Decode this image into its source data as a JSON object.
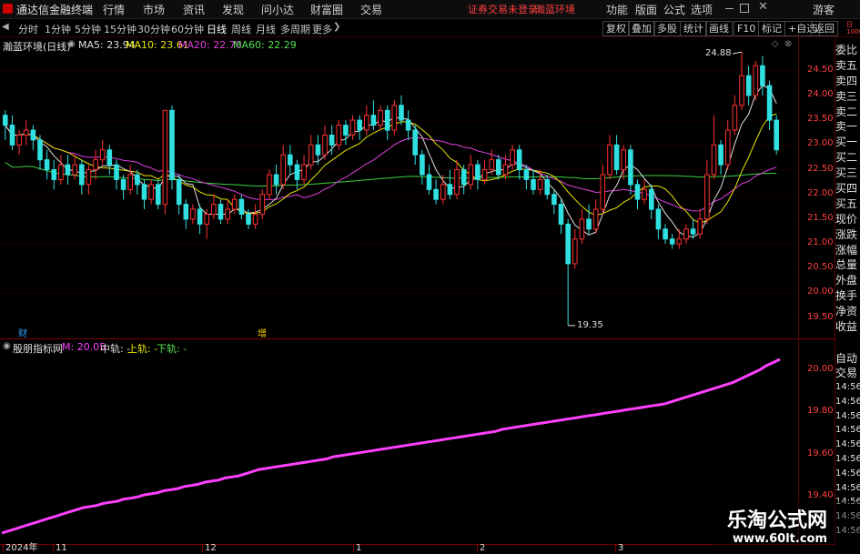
{
  "menubar": {
    "app_title": "通达信金融终端",
    "items": [
      "行情",
      "市场",
      "资讯",
      "发现",
      "问小达",
      "财富圈",
      "交易"
    ],
    "notice": "证券交易未登录",
    "stock_name_red": "瀚蓝环境",
    "right_items": [
      "功能",
      "版面",
      "公式",
      "选项"
    ],
    "guest": "游客"
  },
  "toolbar": {
    "periods": [
      "分时",
      "1分钟",
      "5分钟",
      "15分钟",
      "30分钟",
      "60分钟",
      "日线",
      "周线",
      "月线",
      "多周期",
      "更多"
    ],
    "active_period": "日线",
    "right_buttons": [
      "复权",
      "叠加",
      "多股",
      "统计",
      "画线",
      "F10",
      "标记",
      "+自选",
      "返回"
    ]
  },
  "chart_header": {
    "title": "瀚蓝环境(日线)",
    "ma5": "MA5: 23.94",
    "ma10": "MA10: 23.61",
    "ma20": "MA20: 22.70",
    "ma60": "MA60: 22.29"
  },
  "side_panel": {
    "items": [
      "委比",
      "卖五",
      "卖四",
      "卖三",
      "卖二",
      "卖一",
      "买一",
      "买二",
      "买三",
      "买四",
      "买五",
      "现价",
      "涨跌",
      "涨幅",
      "总量",
      "外盘",
      "换手",
      "净资",
      "收益"
    ],
    "bottom_items": [
      "自动",
      "交易"
    ],
    "times": [
      "14:56",
      "14:56",
      "14:56",
      "14:56",
      "14:56",
      "14:56",
      "14:56",
      "14:56",
      "14:56",
      "14:56",
      "14:56"
    ],
    "top_tag": "日 1000"
  },
  "price_axis": [
    "24.50",
    "24.00",
    "23.50",
    "23.00",
    "22.50",
    "22.00",
    "21.50",
    "21.00",
    "20.50",
    "20.00",
    "19.50"
  ],
  "annotations": {
    "high": "24.88",
    "low": "19.35",
    "marker_cai": "财",
    "marker_zeng": "增"
  },
  "indicator": {
    "name": "殷朋指标网",
    "m_label": "M: 20.05",
    "mid_label": "中轨: -",
    "upper_label": "上轨: -",
    "lower_label": "下轨: -",
    "axis": [
      "20.00",
      "19.80",
      "19.60",
      "19.40"
    ]
  },
  "date_axis": [
    "2024年",
    "11",
    "12",
    "1",
    "2",
    "3"
  ],
  "watermark": {
    "title": "乐淘公式网",
    "url": "www.60lt.com"
  },
  "colors": {
    "up": "#ff3030",
    "down": "#30e0e0",
    "ma5": "#e0e0e0",
    "ma10": "#e6e600",
    "ma20": "#e040e0",
    "ma60": "#40d040",
    "indicator": "#ff40ff"
  },
  "chart_data": {
    "type": "candlestick",
    "ylim": [
      19.2,
      24.9
    ],
    "candles": [
      [
        23.6,
        23.4,
        23.7,
        23.1
      ],
      [
        23.4,
        23.0,
        23.6,
        22.9
      ],
      [
        23.0,
        23.2,
        23.3,
        22.8
      ],
      [
        23.2,
        23.3,
        23.5,
        23.0
      ],
      [
        23.3,
        23.1,
        23.4,
        22.9
      ],
      [
        23.1,
        22.7,
        23.2,
        22.5
      ],
      [
        22.7,
        22.5,
        22.9,
        22.3
      ],
      [
        22.5,
        22.3,
        22.7,
        22.1
      ],
      [
        22.3,
        22.6,
        22.8,
        22.2
      ],
      [
        22.6,
        22.4,
        22.8,
        22.2
      ],
      [
        22.4,
        22.6,
        22.8,
        22.3
      ],
      [
        22.6,
        22.2,
        22.7,
        22.0
      ],
      [
        22.2,
        22.5,
        22.6,
        22.0
      ],
      [
        22.5,
        22.7,
        22.9,
        22.3
      ],
      [
        22.7,
        22.9,
        23.1,
        22.6
      ],
      [
        22.9,
        22.6,
        23.0,
        22.4
      ],
      [
        22.6,
        22.3,
        22.7,
        22.1
      ],
      [
        22.3,
        22.1,
        22.4,
        21.9
      ],
      [
        22.1,
        22.4,
        22.6,
        22.0
      ],
      [
        22.4,
        22.2,
        22.5,
        22.0
      ],
      [
        22.2,
        21.9,
        22.3,
        21.7
      ],
      [
        21.9,
        22.2,
        22.3,
        21.8
      ],
      [
        22.2,
        21.8,
        22.3,
        21.7
      ],
      [
        21.8,
        23.7,
        23.7,
        21.6
      ],
      [
        23.7,
        22.3,
        23.8,
        22.1
      ],
      [
        22.3,
        21.8,
        22.4,
        21.6
      ],
      [
        21.8,
        21.5,
        21.9,
        21.3
      ],
      [
        21.5,
        21.7,
        21.8,
        21.4
      ],
      [
        21.7,
        21.4,
        21.8,
        21.2
      ],
      [
        21.4,
        21.6,
        21.7,
        21.1
      ],
      [
        21.6,
        21.8,
        22.0,
        21.5
      ],
      [
        21.8,
        21.5,
        21.9,
        21.4
      ],
      [
        21.5,
        21.7,
        21.9,
        21.4
      ],
      [
        21.7,
        21.9,
        22.0,
        21.6
      ],
      [
        21.9,
        21.6,
        22.0,
        21.5
      ],
      [
        21.6,
        21.4,
        21.7,
        21.3
      ],
      [
        21.4,
        21.6,
        21.8,
        21.3
      ],
      [
        21.6,
        22.0,
        22.1,
        21.5
      ],
      [
        22.0,
        22.4,
        22.5,
        21.9
      ],
      [
        22.4,
        22.2,
        22.6,
        22.0
      ],
      [
        22.2,
        22.8,
        23.0,
        22.1
      ],
      [
        22.8,
        22.6,
        23.0,
        22.4
      ],
      [
        22.6,
        22.3,
        22.7,
        22.1
      ],
      [
        22.3,
        22.6,
        22.8,
        22.2
      ],
      [
        22.6,
        23.0,
        23.2,
        22.5
      ],
      [
        23.0,
        22.8,
        23.2,
        22.6
      ],
      [
        22.8,
        23.2,
        23.4,
        22.7
      ],
      [
        23.2,
        23.0,
        23.4,
        22.8
      ],
      [
        23.0,
        23.4,
        23.5,
        22.9
      ],
      [
        23.4,
        23.2,
        23.5,
        23.0
      ],
      [
        23.2,
        23.5,
        23.6,
        23.1
      ],
      [
        23.5,
        23.3,
        23.6,
        23.1
      ],
      [
        23.3,
        23.6,
        23.8,
        23.2
      ],
      [
        23.6,
        23.4,
        23.9,
        23.3
      ],
      [
        23.4,
        23.7,
        23.8,
        23.3
      ],
      [
        23.7,
        23.3,
        23.8,
        23.1
      ],
      [
        23.3,
        23.8,
        23.9,
        23.2
      ],
      [
        23.8,
        23.5,
        24.0,
        23.4
      ],
      [
        23.5,
        23.3,
        23.7,
        23.1
      ],
      [
        23.3,
        22.8,
        23.4,
        22.6
      ],
      [
        22.8,
        22.4,
        22.9,
        22.2
      ],
      [
        22.4,
        22.1,
        22.6,
        22.0
      ],
      [
        22.1,
        21.9,
        22.3,
        21.8
      ],
      [
        21.9,
        22.2,
        22.4,
        21.8
      ],
      [
        22.2,
        22.0,
        22.5,
        21.9
      ],
      [
        22.0,
        22.5,
        22.7,
        21.9
      ],
      [
        22.5,
        22.2,
        22.6,
        22.0
      ],
      [
        22.2,
        22.6,
        22.8,
        22.1
      ],
      [
        22.6,
        22.3,
        22.7,
        22.1
      ],
      [
        22.3,
        22.5,
        22.7,
        22.2
      ],
      [
        22.5,
        22.7,
        22.9,
        22.4
      ],
      [
        22.7,
        22.4,
        22.8,
        22.3
      ],
      [
        22.4,
        22.6,
        22.8,
        22.3
      ],
      [
        22.6,
        22.9,
        23.0,
        22.5
      ],
      [
        22.9,
        22.5,
        23.0,
        22.3
      ],
      [
        22.5,
        22.3,
        22.6,
        22.1
      ],
      [
        22.3,
        22.1,
        22.5,
        22.0
      ],
      [
        22.1,
        22.3,
        22.5,
        22.0
      ],
      [
        22.3,
        22.0,
        22.4,
        21.9
      ],
      [
        22.0,
        21.8,
        22.1,
        21.6
      ],
      [
        21.8,
        21.4,
        21.9,
        21.2
      ],
      [
        21.4,
        20.6,
        21.5,
        19.35
      ],
      [
        20.6,
        21.1,
        21.3,
        20.5
      ],
      [
        21.1,
        21.5,
        21.7,
        21.0
      ],
      [
        21.5,
        21.3,
        21.8,
        21.2
      ],
      [
        21.3,
        21.7,
        21.9,
        21.2
      ],
      [
        21.7,
        22.4,
        22.6,
        21.6
      ],
      [
        22.4,
        23.0,
        23.2,
        22.3
      ],
      [
        23.0,
        22.5,
        23.2,
        22.4
      ],
      [
        22.5,
        22.9,
        23.0,
        22.3
      ],
      [
        22.9,
        22.2,
        23.0,
        22.0
      ],
      [
        22.2,
        21.9,
        22.3,
        21.7
      ],
      [
        21.9,
        22.1,
        22.3,
        21.8
      ],
      [
        22.1,
        21.7,
        22.2,
        21.5
      ],
      [
        21.7,
        21.3,
        21.8,
        21.1
      ],
      [
        21.3,
        21.1,
        21.4,
        21.0
      ],
      [
        21.1,
        21.0,
        21.2,
        20.9
      ],
      [
        21.0,
        21.1,
        21.3,
        20.9
      ],
      [
        21.1,
        21.3,
        21.4,
        21.0
      ],
      [
        21.3,
        21.2,
        21.5,
        21.1
      ],
      [
        21.2,
        21.5,
        21.7,
        21.1
      ],
      [
        21.5,
        22.4,
        22.7,
        21.4
      ],
      [
        22.4,
        23.0,
        23.6,
        22.3
      ],
      [
        23.0,
        22.6,
        23.1,
        22.4
      ],
      [
        22.6,
        23.3,
        23.5,
        22.5
      ],
      [
        23.3,
        23.8,
        24.0,
        23.2
      ],
      [
        23.8,
        24.4,
        24.88,
        23.7
      ],
      [
        24.4,
        24.0,
        24.6,
        23.8
      ],
      [
        24.0,
        24.6,
        24.7,
        23.9
      ],
      [
        24.6,
        24.2,
        24.8,
        24.0
      ],
      [
        24.2,
        23.5,
        24.3,
        23.3
      ],
      [
        23.5,
        22.9,
        23.6,
        22.8
      ]
    ],
    "indicator_values": [
      19.23,
      19.24,
      19.25,
      19.26,
      19.27,
      19.28,
      19.29,
      19.3,
      19.31,
      19.32,
      19.33,
      19.34,
      19.35,
      19.355,
      19.36,
      19.37,
      19.375,
      19.38,
      19.39,
      19.395,
      19.4,
      19.41,
      19.415,
      19.42,
      19.43,
      19.435,
      19.44,
      19.45,
      19.455,
      19.46,
      19.47,
      19.475,
      19.48,
      19.49,
      19.495,
      19.5,
      19.51,
      19.52,
      19.53,
      19.535,
      19.54,
      19.545,
      19.55,
      19.555,
      19.56,
      19.565,
      19.57,
      19.575,
      19.58,
      19.59,
      19.595,
      19.6,
      19.605,
      19.61,
      19.615,
      19.62,
      19.625,
      19.63,
      19.635,
      19.64,
      19.645,
      19.65,
      19.655,
      19.66,
      19.665,
      19.67,
      19.675,
      19.68,
      19.685,
      19.69,
      19.695,
      19.7,
      19.705,
      19.71,
      19.72,
      19.725,
      19.73,
      19.735,
      19.74,
      19.745,
      19.75,
      19.755,
      19.76,
      19.765,
      19.77,
      19.775,
      19.78,
      19.785,
      19.79,
      19.795,
      19.8,
      19.805,
      19.81,
      19.815,
      19.82,
      19.825,
      19.83,
      19.835,
      19.84,
      19.85,
      19.86,
      19.87,
      19.88,
      19.89,
      19.9,
      19.91,
      19.92,
      19.93,
      19.94,
      19.955,
      19.97,
      19.985,
      20.0,
      20.02,
      20.035,
      20.05
    ],
    "indicator_ylim": [
      19.2,
      20.08
    ]
  }
}
